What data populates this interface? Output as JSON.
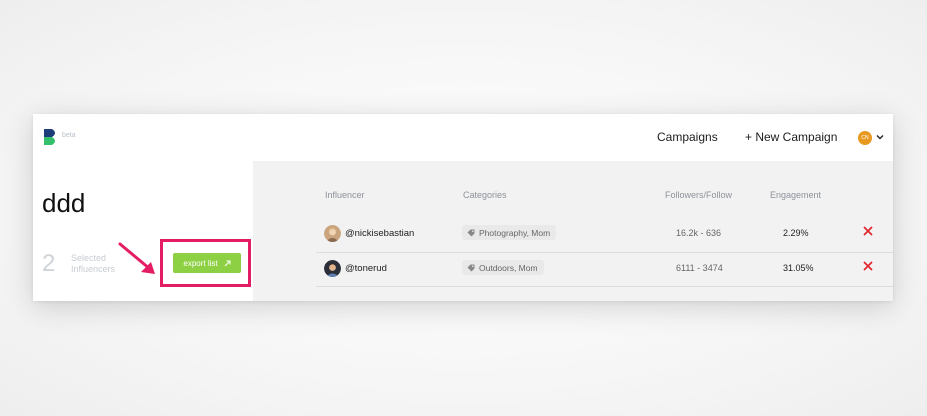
{
  "header": {
    "logo_text": "beta",
    "nav": {
      "campaigns": "Campaigns",
      "new_campaign": "+ New Campaign"
    },
    "user_initials": "CN"
  },
  "left": {
    "list_title": "ddd",
    "selected_count": "2",
    "selected_label": "Selected Influencers",
    "export_label": "export list"
  },
  "table": {
    "columns": [
      "Influencer",
      "Categories",
      "Followers/Follow",
      "Engagement"
    ],
    "rows": [
      {
        "username": "@nickisebastian",
        "categories": "Photography, Mom",
        "followers": "16.2k - 636",
        "engagement": "2.29%"
      },
      {
        "username": "@tonerud",
        "categories": "Outdoors, Mom",
        "followers": "6111 - 3474",
        "engagement": "31.05%"
      }
    ]
  },
  "colors": {
    "accent_green": "#8ed043",
    "highlight_pink": "#e41c63",
    "remove_red": "#e0292f",
    "avatar_orange": "#e89a20"
  }
}
